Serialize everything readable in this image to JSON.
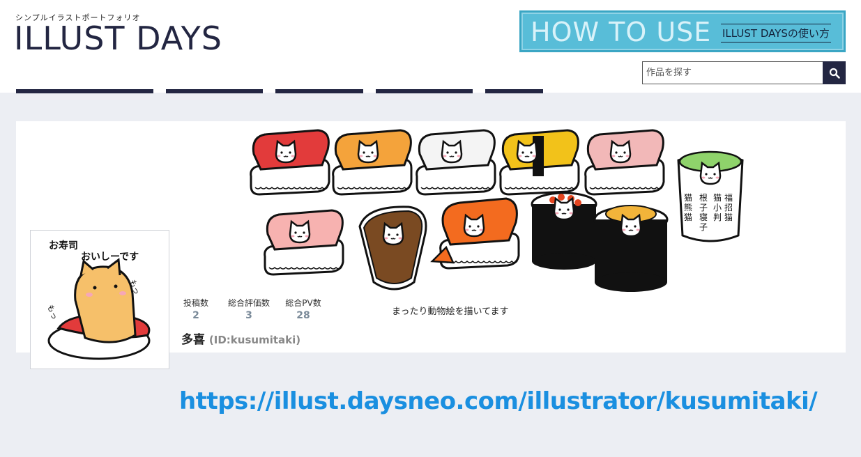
{
  "header": {
    "tagline": "シンプルイラストポートフォリオ",
    "logo": "ILLUST DAYS",
    "howto_main": "HOW TO USE",
    "howto_sub": "ILLUST DAYSの使い方"
  },
  "search": {
    "placeholder": "作品を探す"
  },
  "avatar": {
    "caption_line1": "お寿司",
    "caption_line2": "おいしーです",
    "sfx1": "もっ",
    "sfx2": "もっ"
  },
  "banner": {
    "cup_text": [
      "福招猫",
      "猫小判",
      "根子寝子",
      "猫熊猫"
    ]
  },
  "profile": {
    "stats": [
      {
        "label": "投稿数",
        "value": "2"
      },
      {
        "label": "総合評価数",
        "value": "3"
      },
      {
        "label": "総合PV数",
        "value": "28"
      }
    ],
    "bio": "まったり動物絵を描いてます",
    "name": "多喜",
    "id_text": "(ID:kusumitaki)"
  },
  "footer_url": "https://illust.daysneo.com/illustrator/kusumitaki/",
  "colors": {
    "navy": "#232642",
    "banner_blue": "#58bdd8",
    "link_blue": "#1a8fe0"
  }
}
